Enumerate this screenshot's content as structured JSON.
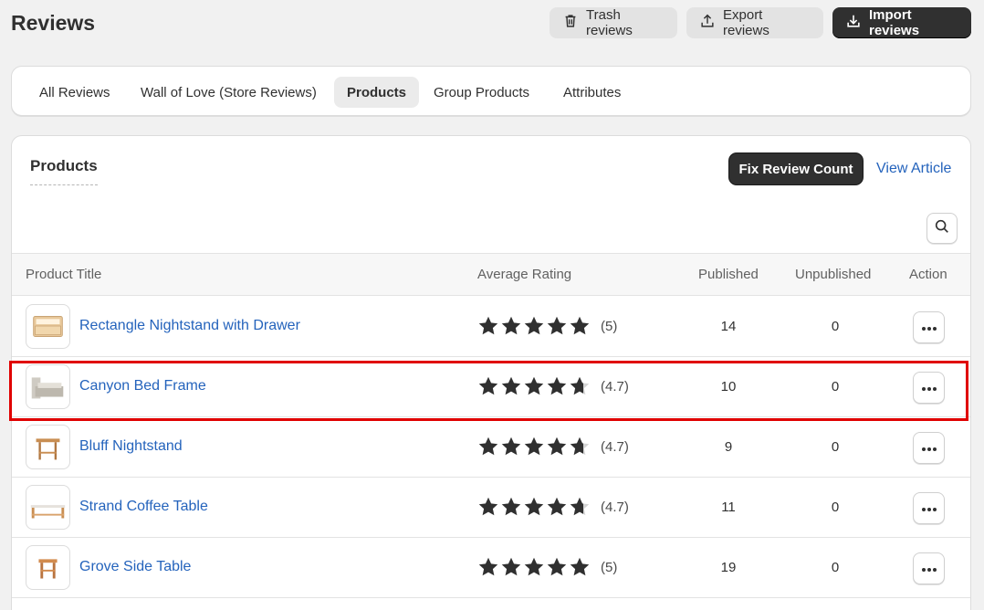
{
  "header": {
    "title": "Reviews",
    "trash_label": "Trash reviews",
    "export_label": "Export reviews",
    "import_label": "Import reviews"
  },
  "tabs": [
    {
      "label": "All Reviews",
      "active": false
    },
    {
      "label": "Wall of Love (Store Reviews)",
      "active": false
    },
    {
      "label": "Products",
      "active": true
    },
    {
      "label": "Group Products",
      "active": false
    },
    {
      "label": "Attributes",
      "active": false
    }
  ],
  "card": {
    "title": "Products",
    "fix_label": "Fix Review Count",
    "view_article_label": "View Article"
  },
  "table": {
    "columns": [
      "Product Title",
      "Average Rating",
      "Published",
      "Unpublished",
      "Action"
    ],
    "rows": [
      {
        "title": "Rectangle Nightstand with Drawer",
        "rating": 5,
        "rating_label": "(5)",
        "published": "14",
        "unpublished": "0",
        "thumb": "nightstand-drawer"
      },
      {
        "title": "Canyon Bed Frame",
        "rating": 4.7,
        "rating_label": "(4.7)",
        "published": "10",
        "unpublished": "0",
        "thumb": "bed-frame"
      },
      {
        "title": "Bluff Nightstand",
        "rating": 4.7,
        "rating_label": "(4.7)",
        "published": "9",
        "unpublished": "0",
        "thumb": "nightstand"
      },
      {
        "title": "Strand Coffee Table",
        "rating": 4.7,
        "rating_label": "(4.7)",
        "published": "11",
        "unpublished": "0",
        "thumb": "coffee-table"
      },
      {
        "title": "Grove Side Table",
        "rating": 5,
        "rating_label": "(5)",
        "published": "19",
        "unpublished": "0",
        "thumb": "side-table"
      }
    ]
  },
  "colors": {
    "link": "#2463bc",
    "primary_button": "#303030",
    "highlight": "#e00000",
    "star": "#303030"
  }
}
